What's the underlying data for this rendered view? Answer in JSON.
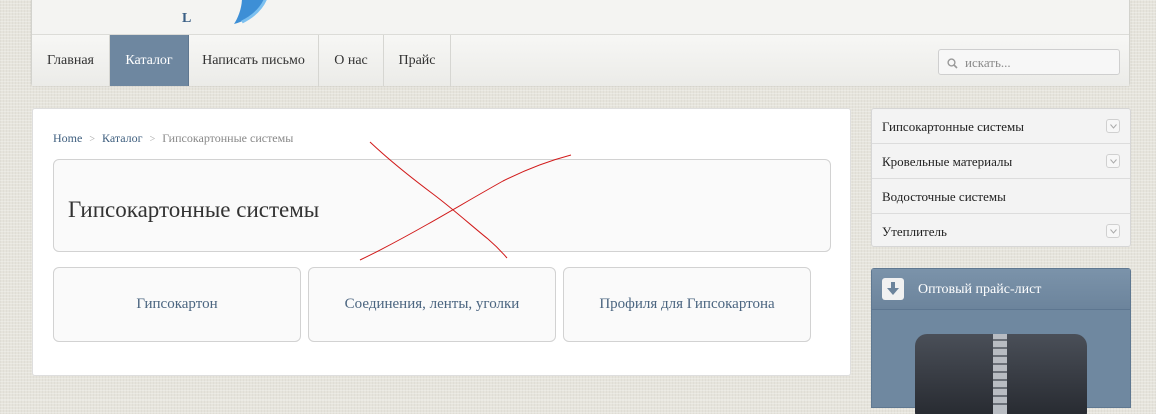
{
  "header": {
    "logo_letter": "L",
    "nav": [
      {
        "label": "Главная",
        "active": false
      },
      {
        "label": "Каталог",
        "active": true
      },
      {
        "label": "Написать письмо",
        "active": false
      },
      {
        "label": "О нас",
        "active": false
      },
      {
        "label": "Прайс",
        "active": false
      }
    ],
    "search": {
      "placeholder": "искать...",
      "icon": "search-icon"
    }
  },
  "breadcrumb": {
    "items": [
      "Home",
      "Каталог"
    ],
    "current": "Гипсокартонные системы",
    "separator_icon": "chevron-right-icon"
  },
  "page": {
    "title": "Гипсокартонные системы",
    "categories": [
      "Гипсокартон",
      "Соединения, ленты, уголки",
      "Профиля для Гипсокартона"
    ]
  },
  "sidebar": {
    "menu": [
      {
        "label": "Гипсокартонные системы",
        "has_submenu": true
      },
      {
        "label": "Кровельные материалы",
        "has_submenu": true
      },
      {
        "label": "Водосточные системы",
        "has_submenu": false
      },
      {
        "label": "Утеплитель",
        "has_submenu": true
      }
    ],
    "price": {
      "title": "Оптовый прайс-лист",
      "icon": "download-icon",
      "image": "zip-archive-icon"
    }
  },
  "colors": {
    "accent": "#6e87a0",
    "link": "#4b6580",
    "scribble": "#d11a1a"
  }
}
